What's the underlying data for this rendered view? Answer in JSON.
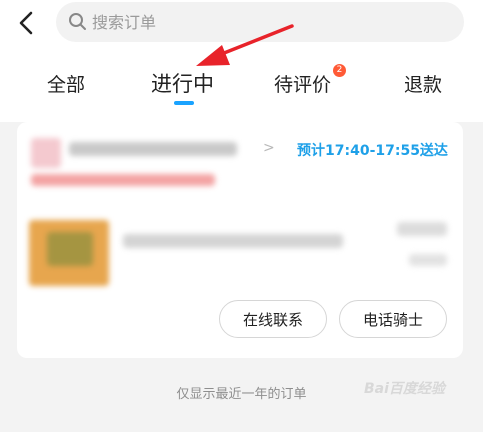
{
  "header": {
    "back_icon": "chevron-left-icon",
    "search": {
      "placeholder": "搜索订单",
      "value": "",
      "icon": "search-icon"
    }
  },
  "tabs": [
    {
      "label": "全部",
      "active": false
    },
    {
      "label": "进行中",
      "active": true
    },
    {
      "label": "待评价",
      "active": false,
      "badge": "2"
    },
    {
      "label": "退款",
      "active": false
    }
  ],
  "order": {
    "eta": "预计17:40-17:55送达",
    "actions": {
      "contact_label": "在线联系",
      "call_label": "电话骑士"
    }
  },
  "footer": {
    "note": "仅显示最近一年的订单"
  },
  "watermark": "Bai百度经验",
  "colors": {
    "accent": "#1aa3ff",
    "eta": "#1ea0e8",
    "badge": "#ff5a36",
    "annotation_arrow": "#e8232a"
  }
}
